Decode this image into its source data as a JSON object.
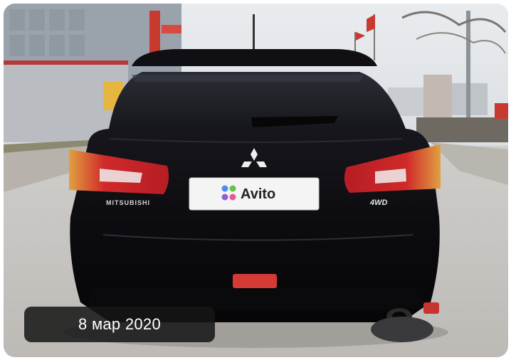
{
  "listing_photo": {
    "date_label": "8 мар 2020",
    "plate_brand": "Avito",
    "badge_left": "MITSUBISHI",
    "badge_right": "4WD"
  },
  "colors": {
    "car_body": "#0d0d12",
    "tail_light": "#c8252b",
    "badge_bg": "#161616",
    "avito_dot_blue": "#4a8ef0",
    "avito_dot_green": "#63c54b",
    "avito_dot_pink": "#e85a8e",
    "avito_dot_purple": "#9b59d6"
  }
}
